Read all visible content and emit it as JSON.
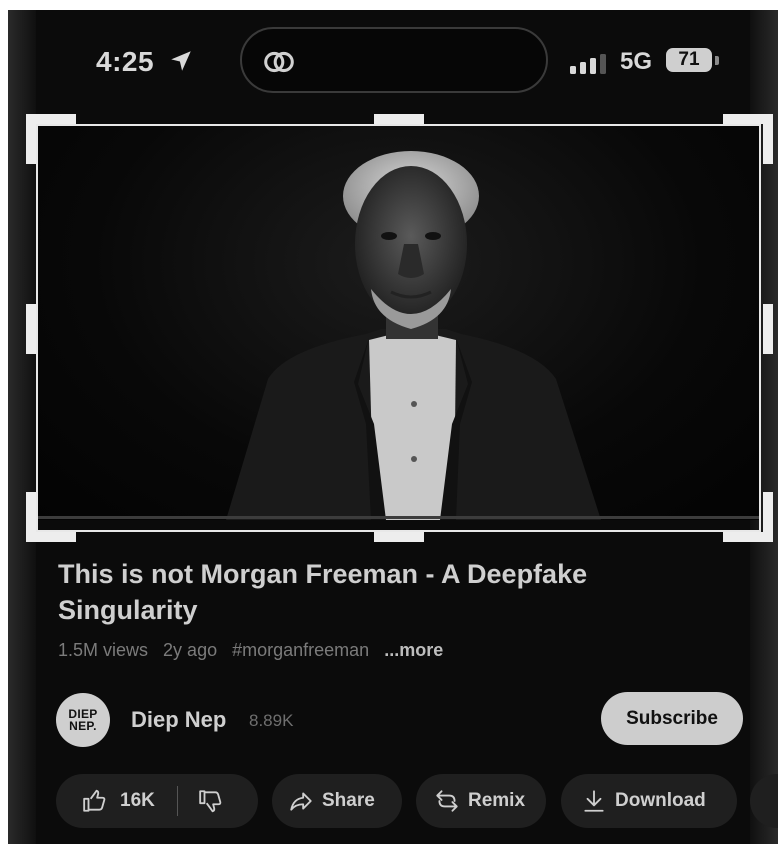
{
  "status_bar": {
    "time": "4:25",
    "network": "5G",
    "battery": "71",
    "location_icon": "location-arrow-icon",
    "app_icon": "threads-icon"
  },
  "video": {
    "title": "This is not Morgan Freeman  -  A Deepfake Singularity",
    "views": "1.5M views",
    "age": "2y ago",
    "hashtag": "#morganfreeman",
    "more_label": "...more"
  },
  "channel": {
    "avatar_text": "DIEP NEP.",
    "name": "Diep Nep",
    "subscribers": "8.89K",
    "subscribe_label": "Subscribe"
  },
  "actions": {
    "like_count": "16K",
    "share_label": "Share",
    "remix_label": "Remix",
    "download_label": "Download"
  },
  "colors": {
    "background": "#0b0b0b",
    "pill": "#1f1f1f",
    "subscribe": "#cdcdcd",
    "frame": "#e8e8e8"
  }
}
